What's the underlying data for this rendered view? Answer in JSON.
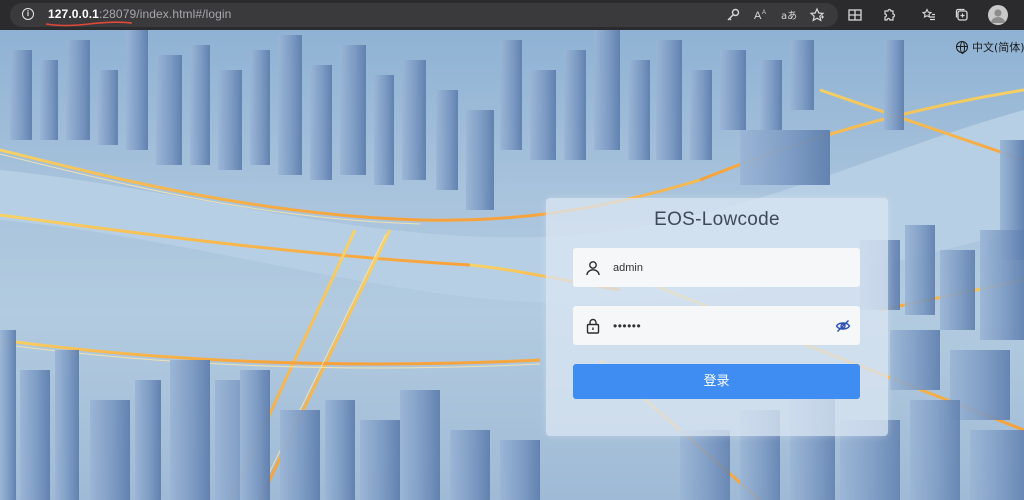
{
  "browser": {
    "url_host": "127.0.0.1",
    "url_port": ":28079",
    "url_path": "/index.html#/login",
    "toolbar_icons": [
      "key-icon",
      "read-aloud-icon",
      "translate-icon",
      "favorite-icon",
      "grid-icon",
      "extensions-icon",
      "favorites-list-icon",
      "collections-icon",
      "profile-icon"
    ]
  },
  "language": {
    "label": "中文(简体)"
  },
  "login": {
    "title": "EOS-Lowcode",
    "username_value": "admin",
    "password_mask": "••••••",
    "submit_label": "登录"
  },
  "colors": {
    "primary_button": "#3f8cf2",
    "browser_bar": "#2b2b2d",
    "card_background": "rgba(218,230,242,0.78)"
  }
}
